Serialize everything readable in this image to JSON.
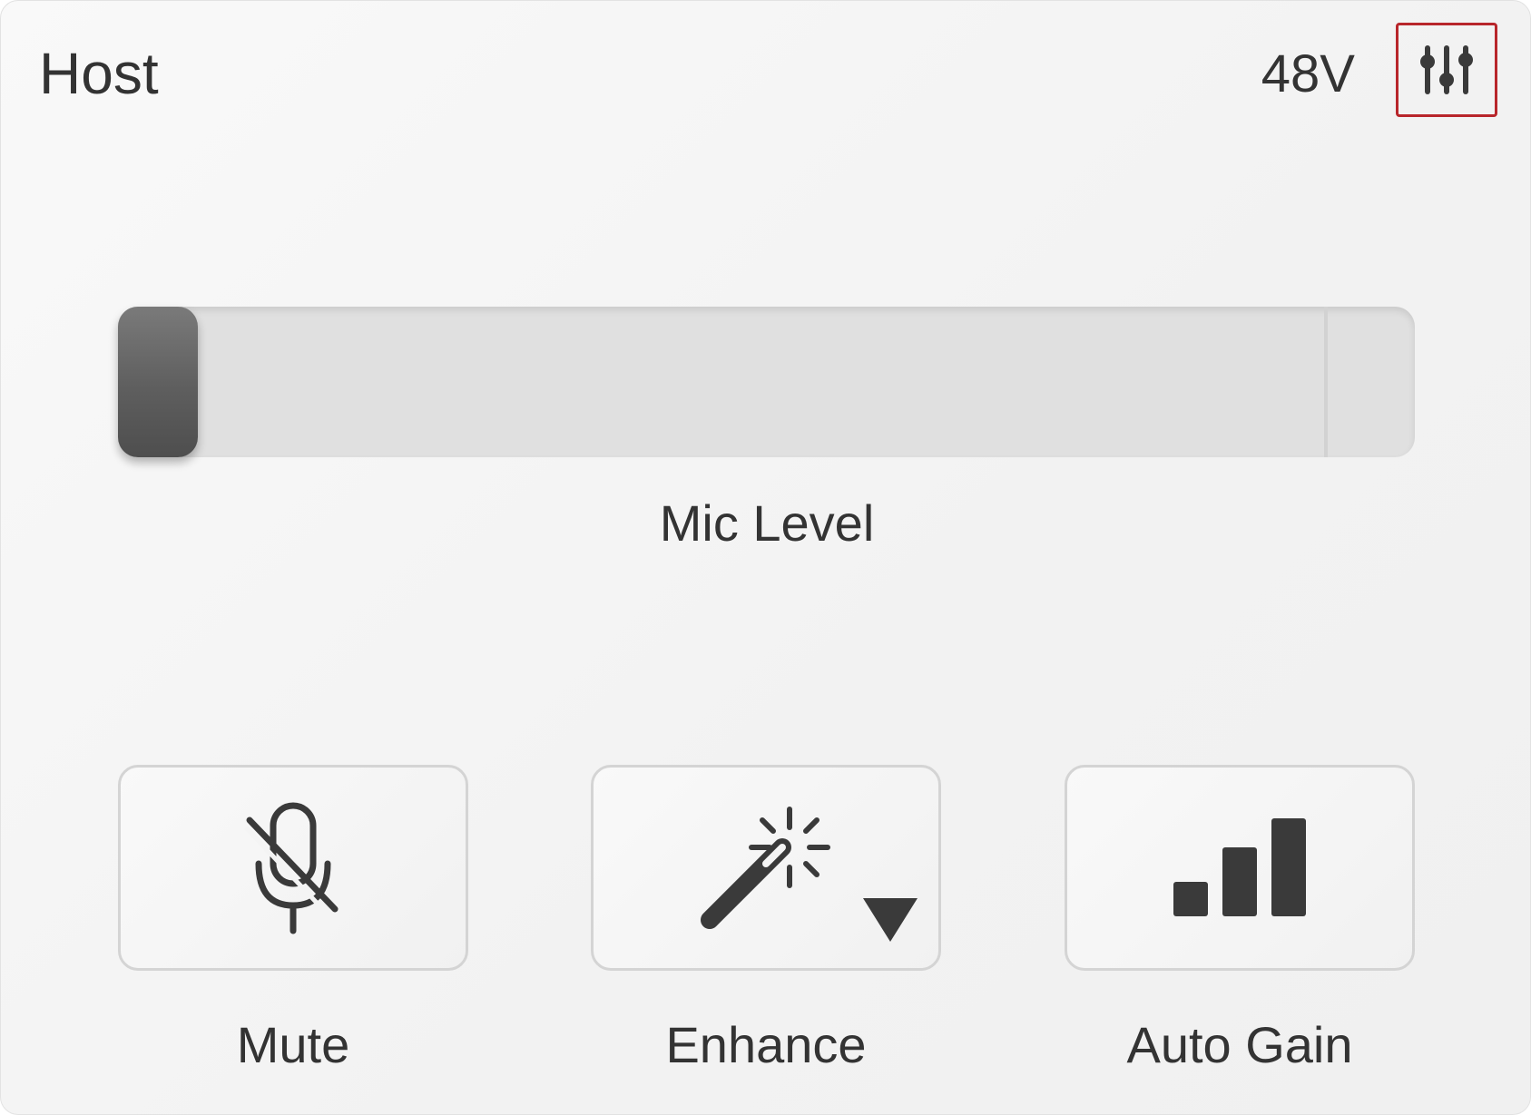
{
  "header": {
    "title": "Host",
    "phantom_power_label": "48V",
    "settings_icon": "sliders-icon"
  },
  "mic_level": {
    "label": "Mic Level",
    "level_fraction": 0.0
  },
  "buttons": {
    "mute": {
      "label": "Mute",
      "icon": "mic-off-icon"
    },
    "enhance": {
      "label": "Enhance",
      "icon": "magic-wand-icon",
      "has_dropdown": true
    },
    "auto_gain": {
      "label": "Auto Gain",
      "icon": "signal-bars-icon"
    }
  },
  "colors": {
    "text": "#333333",
    "icon": "#3a3a3a",
    "highlight_border": "#b8262b",
    "thumb": "#5e5e5e",
    "track": "#e0e0e0"
  }
}
